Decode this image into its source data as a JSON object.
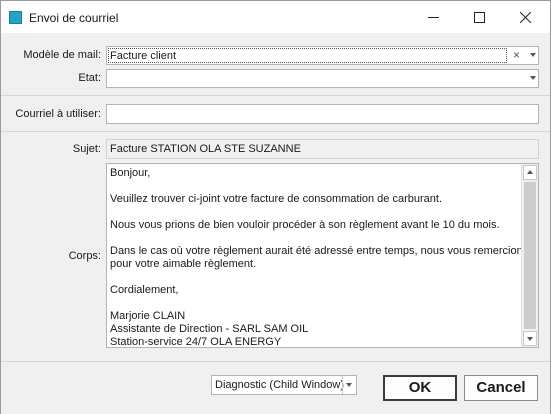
{
  "window": {
    "title": "Envoi de courriel",
    "icons": {
      "app": "app-icon",
      "minimize": "minimize-icon",
      "maximize": "maximize-icon",
      "close": "close-icon"
    }
  },
  "form": {
    "template_label": "Modèle de mail:",
    "template_value": "Facture client",
    "state_label": "Etat:",
    "state_value": "",
    "mail_account_label": "Courriel à utiliser:",
    "mail_account_value": "",
    "subject_label": "Sujet:",
    "subject_value": "Facture STATION OLA STE SUZANNE",
    "body_label": "Corps:",
    "body_lines": [
      "Bonjour,",
      "",
      "Veuillez trouver ci-joint votre facture de consommation de carburant.",
      "",
      "Nous vous prions de bien vouloir procéder à son règlement avant le 10 du mois.",
      "",
      "Dans le cas où votre règlement aurait été adressé entre temps, nous vous remercions",
      "pour votre aimable règlement.",
      "",
      "Cordialement,",
      "",
      "Marjorie CLAIN",
      "Assistante de Direction - SARL SAM OIL",
      "Station-service 24/7 OLA ENERGY"
    ]
  },
  "footer": {
    "mode_value": "Diagnostic (Child Window)",
    "ok_label": "OK",
    "cancel_label": "Cancel"
  },
  "colors": {
    "accent": "#1ea5c8",
    "window_bg": "#f0f0f0"
  }
}
